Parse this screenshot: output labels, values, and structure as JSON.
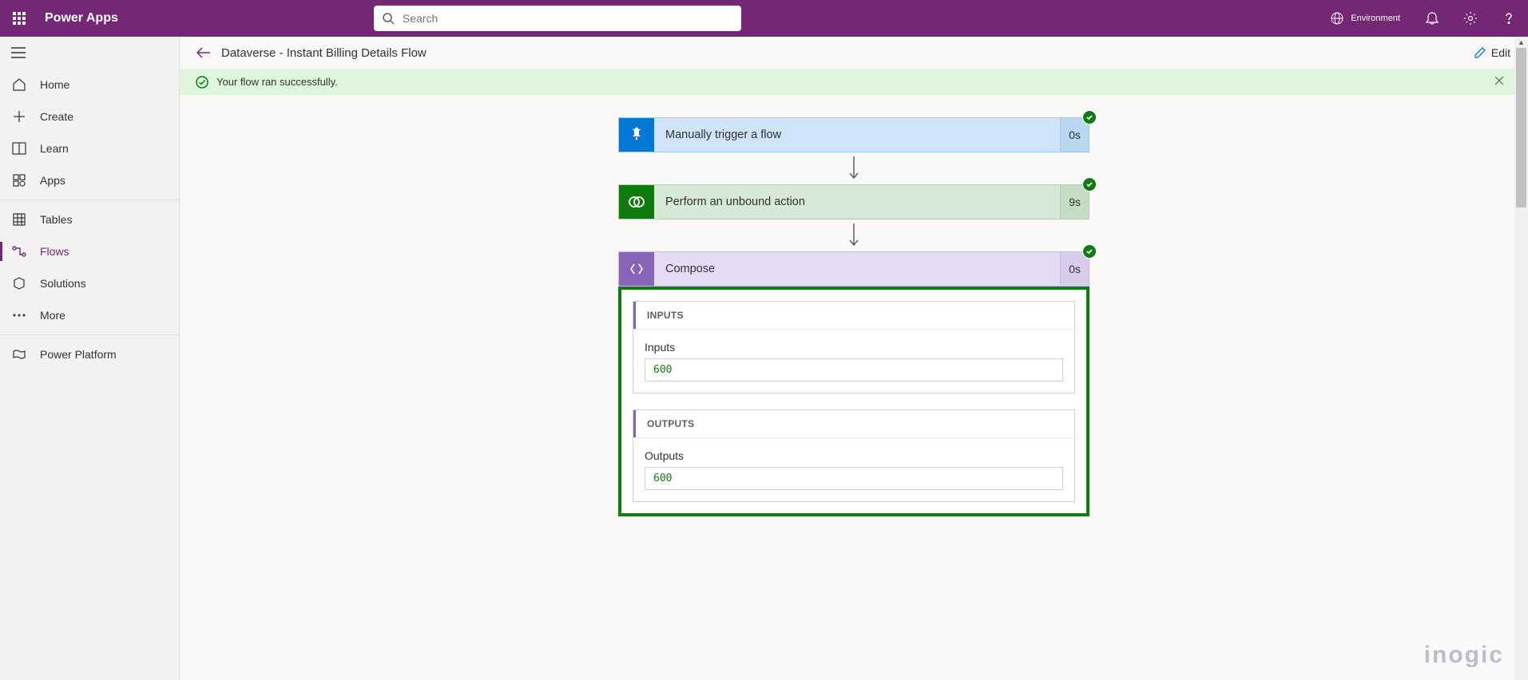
{
  "header": {
    "app_title": "Power Apps",
    "search_placeholder": "Search",
    "environment_label": "Environment"
  },
  "sidebar": {
    "items": [
      {
        "label": "Home"
      },
      {
        "label": "Create"
      },
      {
        "label": "Learn"
      },
      {
        "label": "Apps"
      },
      {
        "label": "Tables"
      },
      {
        "label": "Flows"
      },
      {
        "label": "Solutions"
      },
      {
        "label": "More"
      },
      {
        "label": "Power Platform"
      }
    ]
  },
  "toolbar": {
    "breadcrumb": "Dataverse - Instant Billing Details Flow",
    "edit_label": "Edit"
  },
  "success": {
    "message": "Your flow ran successfully."
  },
  "flow": {
    "steps": [
      {
        "title": "Manually trigger a flow",
        "duration": "0s"
      },
      {
        "title": "Perform an unbound action",
        "duration": "9s"
      },
      {
        "title": "Compose",
        "duration": "0s"
      }
    ],
    "compose": {
      "inputs_header": "INPUTS",
      "inputs_label": "Inputs",
      "inputs_value": "600",
      "outputs_header": "OUTPUTS",
      "outputs_label": "Outputs",
      "outputs_value": "600"
    }
  },
  "watermark": "inogic"
}
